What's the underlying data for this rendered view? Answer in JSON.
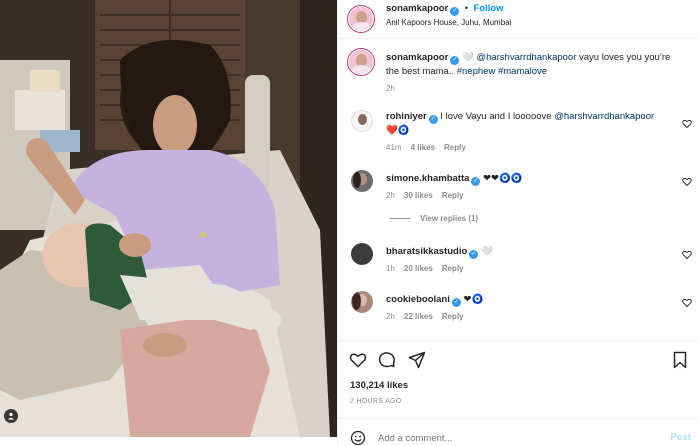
{
  "post": {
    "username": "sonamkapoor",
    "separator": "•",
    "follow_label": "Follow",
    "location": "Anil Kapoors House, Juhu, Mumbai"
  },
  "caption": {
    "username": "sonamkapoor",
    "emoji": "🤍",
    "mention": "@harshvarrdhankapoor",
    "text": " vayu loves you you’re the best mama.. ",
    "hashtags": "#nephew #mamalove",
    "time": "2h"
  },
  "comments": [
    {
      "username": "rohiniyer",
      "text": " I love Vayu and I looooove ",
      "mention": "@harshvarrdhankapoor",
      "emoji": "❤️🧿",
      "time": "41m",
      "likes": "4 likes",
      "reply": "Reply"
    },
    {
      "username": "simone.khambatta",
      "text": "",
      "mention": "",
      "emoji": "❤❤🧿🧿",
      "time": "2h",
      "likes": "30 likes",
      "reply": "Reply",
      "view_replies": "View replies (1)"
    },
    {
      "username": "bharatsikkastudio",
      "text": "",
      "mention": "",
      "emoji": "🤍",
      "time": "1h",
      "likes": "20 likes",
      "reply": "Reply"
    },
    {
      "username": "cookieboolani",
      "text": "",
      "mention": "",
      "emoji": "❤🧿",
      "time": "2h",
      "likes": "22 likes",
      "reply": "Reply"
    }
  ],
  "actions": {
    "like_icon": "heart-icon",
    "comment_icon": "comment-icon",
    "share_icon": "share-icon"
  },
  "stats": {
    "likes": "130,214 likes",
    "time_ago": "2 HOURS AGO"
  },
  "composer": {
    "placeholder": "Add a comment...",
    "post_label": "Post"
  },
  "colors": {
    "link": "#00376b",
    "follow": "#0095f6",
    "verified": "#3897f0",
    "muted": "#8e8e8e"
  }
}
